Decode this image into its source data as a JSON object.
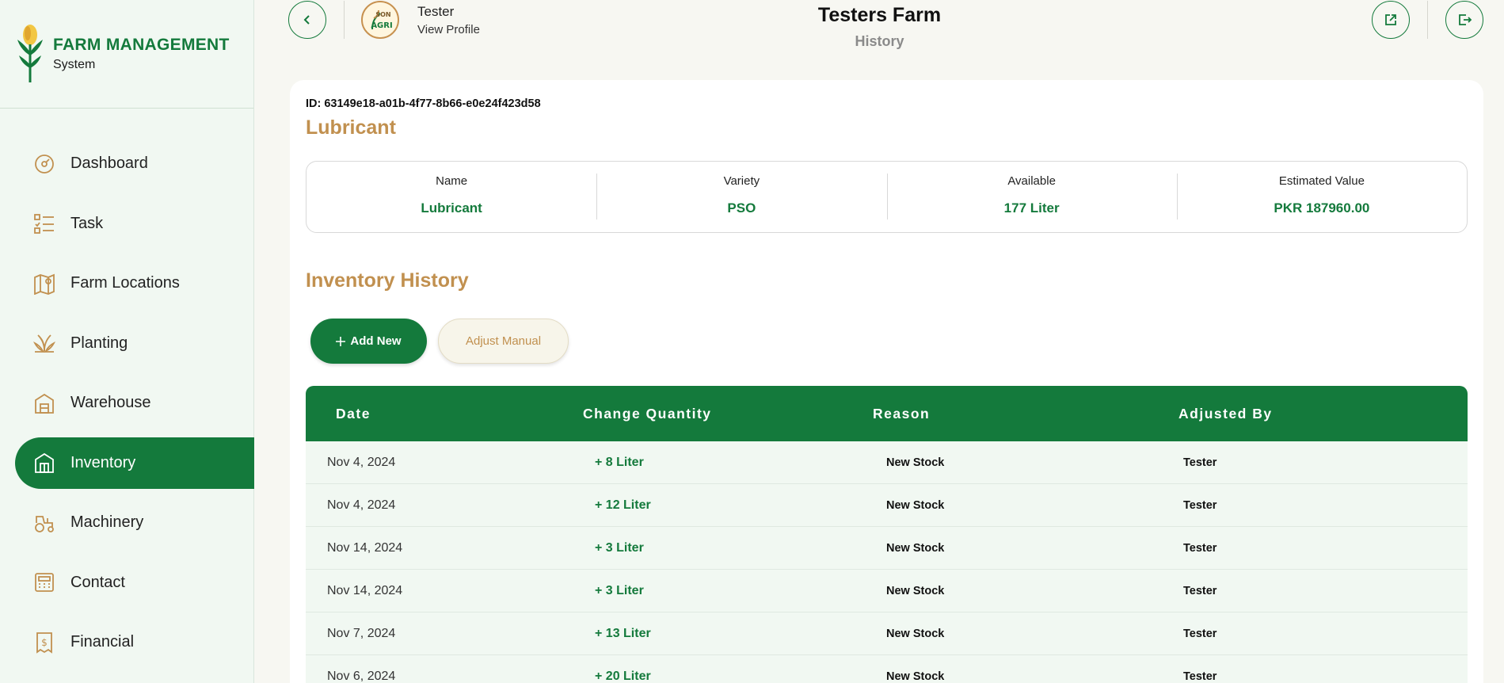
{
  "brand": {
    "title": "FARM MANAGEMENT",
    "subtitle": "System"
  },
  "sidebar": {
    "items": [
      {
        "label": "Dashboard",
        "icon": "dashboard-icon"
      },
      {
        "label": "Task",
        "icon": "task-list-icon"
      },
      {
        "label": "Farm Locations",
        "icon": "map-pin-icon"
      },
      {
        "label": "Planting",
        "icon": "plant-icon"
      },
      {
        "label": "Warehouse",
        "icon": "warehouse-icon"
      },
      {
        "label": "Inventory",
        "icon": "inventory-icon",
        "active": true
      },
      {
        "label": "Machinery",
        "icon": "tractor-icon"
      },
      {
        "label": "Contact",
        "icon": "contact-icon"
      },
      {
        "label": "Financial",
        "icon": "receipt-icon"
      }
    ]
  },
  "header": {
    "profile_name": "Tester",
    "profile_link": "View Profile",
    "avatar_text": "SONCAVE AGRI",
    "farm_title": "Testers Farm",
    "page_subtitle": "History"
  },
  "item": {
    "id_label": "ID: 63149e18-a01b-4f77-8b66-e0e24f423d58",
    "name": "Lubricant",
    "summary": [
      {
        "label": "Name",
        "value": "Lubricant"
      },
      {
        "label": "Variety",
        "value": "PSO"
      },
      {
        "label": "Available",
        "value": "177 Liter"
      },
      {
        "label": "Estimated Value",
        "value": "PKR 187960.00"
      }
    ]
  },
  "history": {
    "title": "Inventory History",
    "add_label": "Add New",
    "adjust_label": "Adjust Manual",
    "columns": [
      "Date",
      "Change Quantity",
      "Reason",
      "Adjusted By"
    ],
    "rows": [
      {
        "date": "Nov 4, 2024",
        "qty": "+ 8 Liter",
        "reason": "New Stock",
        "by": "Tester"
      },
      {
        "date": "Nov 4, 2024",
        "qty": "+ 12 Liter",
        "reason": "New Stock",
        "by": "Tester"
      },
      {
        "date": "Nov 14, 2024",
        "qty": "+ 3 Liter",
        "reason": "New Stock",
        "by": "Tester"
      },
      {
        "date": "Nov 14, 2024",
        "qty": "+ 3 Liter",
        "reason": "New Stock",
        "by": "Tester"
      },
      {
        "date": "Nov 7, 2024",
        "qty": "+ 13 Liter",
        "reason": "New Stock",
        "by": "Tester"
      },
      {
        "date": "Nov 6, 2024",
        "qty": "+ 20 Liter",
        "reason": "New Stock",
        "by": "Tester"
      }
    ]
  },
  "colors": {
    "primary": "#147a3c",
    "accent": "#c1904f",
    "sidebar_bg": "#f1f8f2"
  }
}
